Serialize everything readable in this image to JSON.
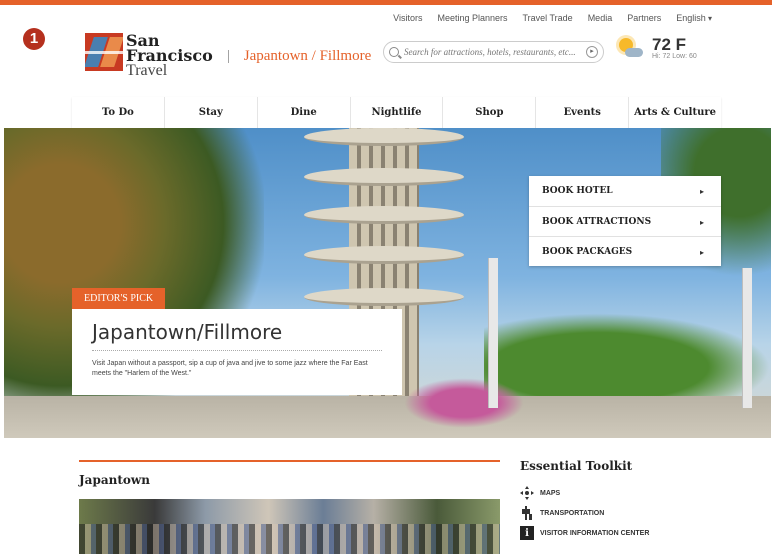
{
  "step_badge": "1",
  "utility_nav": [
    "Visitors",
    "Meeting Planners",
    "Travel Trade",
    "Media",
    "Partners",
    "English"
  ],
  "logo": {
    "line1": "San",
    "line2": "Francisco",
    "line3": "Travel"
  },
  "breadcrumb": {
    "separator": "|",
    "current": "Japantown / Fillmore"
  },
  "search": {
    "placeholder": "Search for attractions, hotels, restaurants, etc..."
  },
  "weather": {
    "icon": "partly-sunny-icon",
    "temp": "72 F",
    "hilo": "Hi: 72 Low: 60"
  },
  "main_nav": [
    "To Do",
    "Stay",
    "Dine",
    "Nightlife",
    "Shop",
    "Events",
    "Arts & Culture"
  ],
  "booking": [
    "BOOK HOTEL",
    "BOOK ATTRACTIONS",
    "BOOK PACKAGES"
  ],
  "editors_pick": {
    "tag": "EDITOR'S PICK",
    "title": "Japantown/Fillmore",
    "description": "Visit Japan without a passport, sip a cup of java and jive to some jazz where the Far East meets the \"Harlem of the West.\""
  },
  "section": {
    "title": "Japantown"
  },
  "toolkit": {
    "title": "Essential Toolkit",
    "items": [
      {
        "icon": "maps-icon",
        "label": "MAPS"
      },
      {
        "icon": "transportation-icon",
        "label": "TRANSPORTATION"
      },
      {
        "icon": "info-icon",
        "label": "VISITOR INFORMATION CENTER"
      }
    ]
  },
  "colors": {
    "accent": "#e5622a",
    "badge": "#b5301e",
    "sun": "#f7b92a"
  }
}
